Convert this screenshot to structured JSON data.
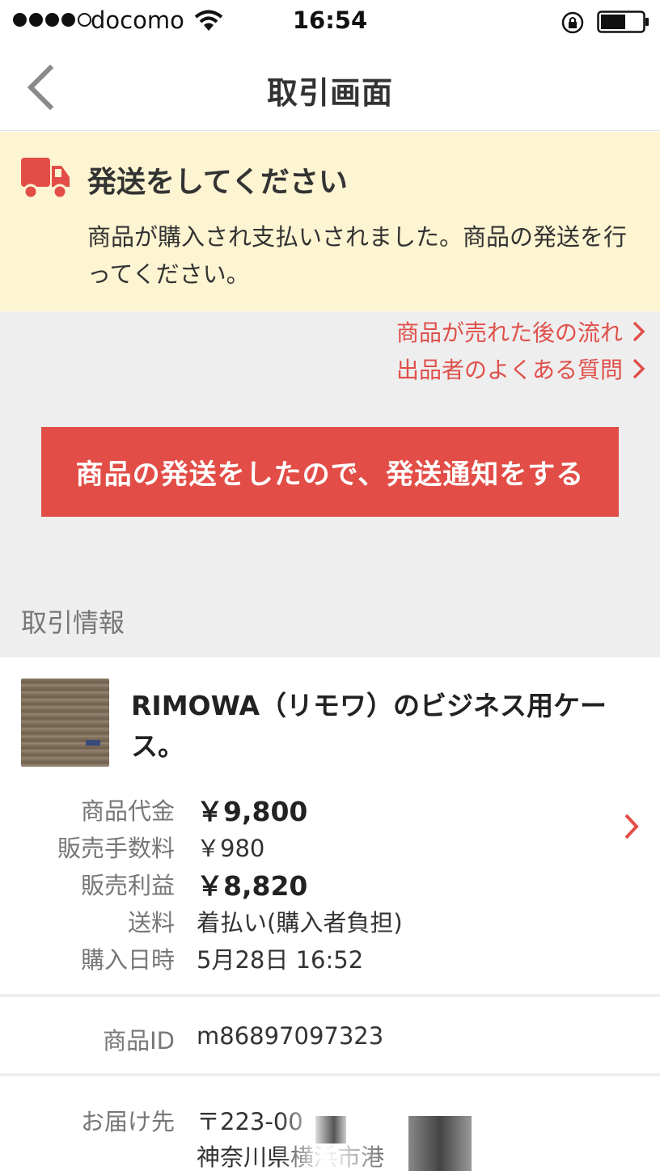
{
  "status_bar": {
    "carrier": "docomo",
    "time": "16:54",
    "signal_bars_filled": 4,
    "signal_bars_total": 5
  },
  "nav": {
    "title": "取引画面"
  },
  "notice": {
    "title": "発送をしてください",
    "body": "商品が購入され支払いされました。商品の発送を行ってください。",
    "icon": "truck-icon",
    "icon_color": "#e24e47"
  },
  "links": [
    {
      "label": "商品が売れた後の流れ"
    },
    {
      "label": "出品者のよくある質問"
    }
  ],
  "cta": {
    "label": "商品の発送をしたので、発送通知をする",
    "color": "#e24e47"
  },
  "section": {
    "heading": "取引情報"
  },
  "item": {
    "title": "RIMOWA（リモワ）のビジネス用ケース。",
    "details": [
      {
        "label": "商品代金",
        "value": "￥9,800"
      },
      {
        "label": "販売手数料",
        "value": "￥980"
      },
      {
        "label": "販売利益",
        "value": "￥8,820"
      },
      {
        "label": "送料",
        "value": "着払い(購入者負担)"
      },
      {
        "label": "購入日時",
        "value": "5月28日 16:52"
      }
    ]
  },
  "product_id": {
    "label": "商品ID",
    "value": "m86897097323"
  },
  "delivery": {
    "label": "お届け先",
    "line1": "〒223-00",
    "line2": "神奈川県横浜市港"
  },
  "colors": {
    "accent": "#e24e47",
    "link": "#e0504a",
    "notice_bg": "#fdf4d2",
    "gray_bg": "#eeeeef"
  }
}
